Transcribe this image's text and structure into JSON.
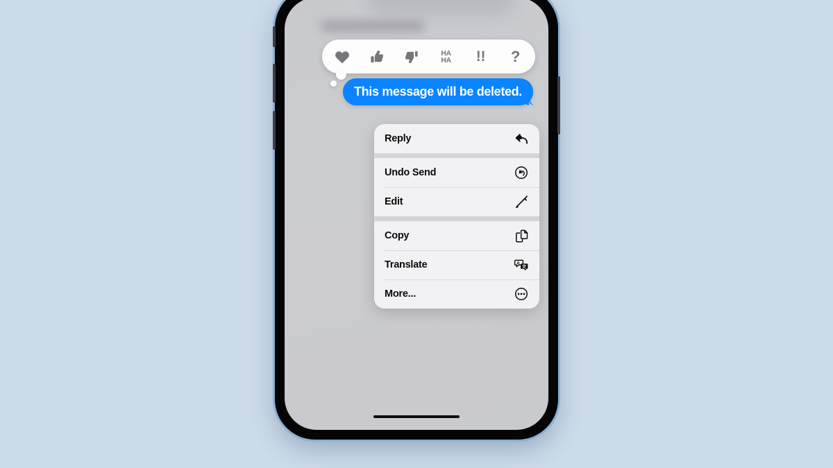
{
  "theme": {
    "page_background": "#ccdbe9",
    "bubble_blue": "#0a84ff",
    "menu_background": "#f2f2f4",
    "menu_separator": "#d4d4d8",
    "screen_dim": "#cbccd0",
    "device_frame": "#050505",
    "device_rim": "#8aafd2"
  },
  "device": {
    "name": "iphone-mockup",
    "buttons": [
      {
        "name": "silent-switch"
      },
      {
        "name": "volume-up-button"
      },
      {
        "name": "volume-down-button"
      },
      {
        "name": "power-button"
      }
    ],
    "home_indicator": ""
  },
  "conversation": {
    "redacted_header": "",
    "redacted_message": "",
    "message": {
      "text": "This message will be deleted.",
      "sender": "outgoing",
      "bubble_color": "#0a84ff"
    }
  },
  "tapbacks": {
    "name": "tapback-reaction-bar",
    "options": [
      {
        "id": "heart",
        "icon": "heart-icon",
        "label": ""
      },
      {
        "id": "thumbsup",
        "icon": "thumbs-up-icon",
        "label": ""
      },
      {
        "id": "thumbsdown",
        "icon": "thumbs-down-icon",
        "label": ""
      },
      {
        "id": "haha",
        "icon": "haha-icon",
        "label": "HA\nHA",
        "line1": "HA",
        "line2": "HA"
      },
      {
        "id": "exclamation",
        "icon": "exclamation-icon",
        "label": "!!"
      },
      {
        "id": "question",
        "icon": "question-mark-icon",
        "label": "?"
      }
    ]
  },
  "context_menu": {
    "name": "message-context-menu",
    "groups": [
      {
        "items": [
          {
            "label": "Reply",
            "icon": "reply-arrow-icon"
          }
        ]
      },
      {
        "items": [
          {
            "label": "Undo Send",
            "icon": "undo-circle-icon"
          },
          {
            "label": "Edit",
            "icon": "pencil-icon"
          }
        ]
      },
      {
        "items": [
          {
            "label": "Copy",
            "icon": "copy-documents-icon"
          },
          {
            "label": "Translate",
            "icon": "translate-icon"
          },
          {
            "label": "More...",
            "icon": "ellipsis-circle-icon"
          }
        ]
      }
    ]
  }
}
